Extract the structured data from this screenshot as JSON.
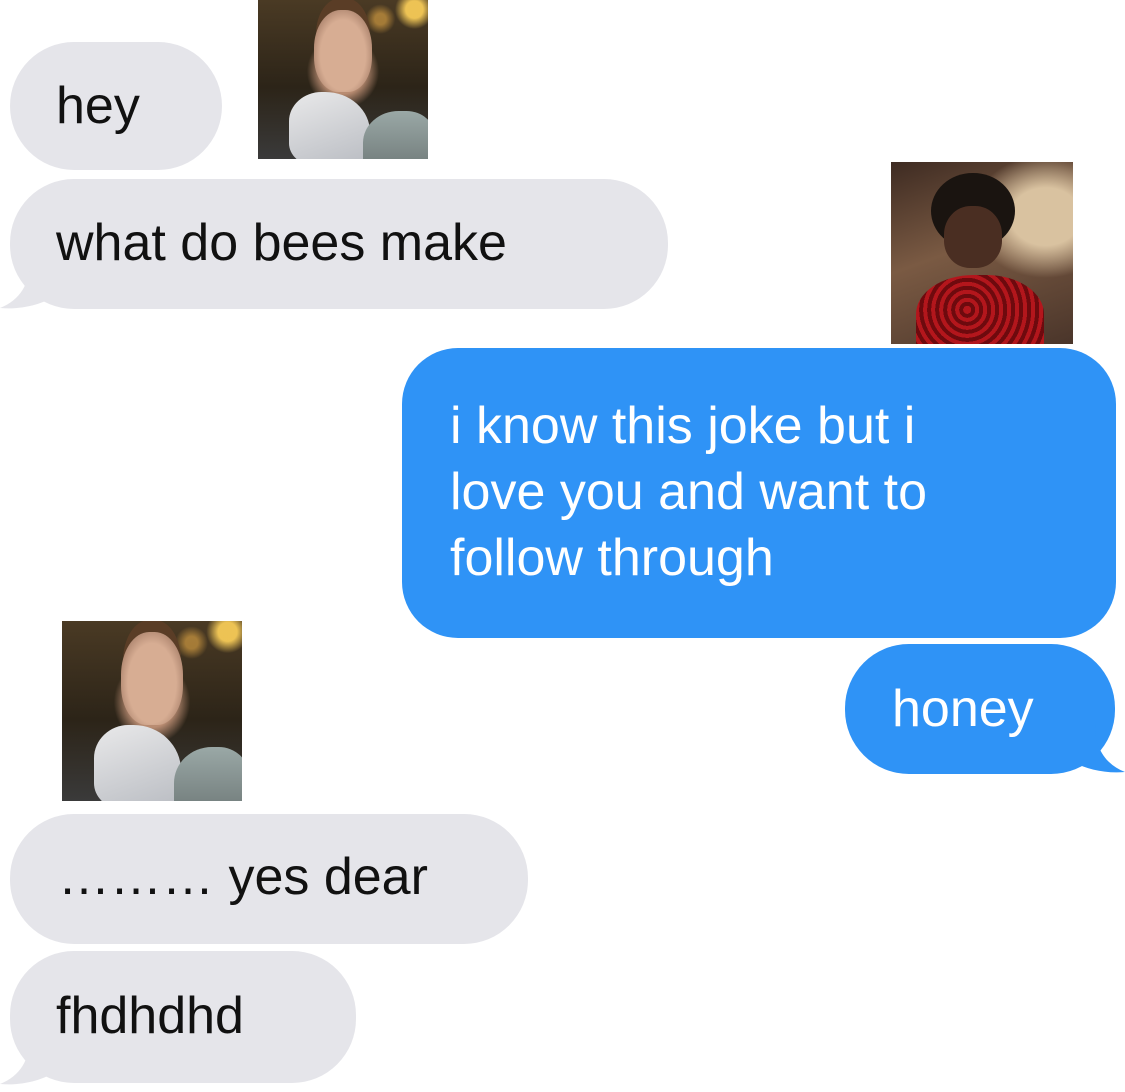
{
  "conversation": {
    "messages": [
      {
        "text": "hey",
        "direction": "received"
      },
      {
        "text": "what do bees make",
        "direction": "received"
      },
      {
        "lines": [
          "i know this joke but i",
          "love you and want to",
          "follow through"
        ],
        "direction": "sent"
      },
      {
        "text": "honey",
        "direction": "sent"
      },
      {
        "text": "……… yes dear",
        "direction": "received"
      },
      {
        "text": "fhdhdhd",
        "direction": "received"
      }
    ],
    "images": [
      {
        "name": "reaction-photo-woman-hand-over-mouth"
      },
      {
        "name": "reaction-photo-woman-red-dress"
      },
      {
        "name": "reaction-photo-woman-hand-over-mouth"
      }
    ]
  },
  "colors": {
    "received_bubble": "#e5e5ea",
    "sent_bubble": "#2f93f6",
    "received_text": "#111111",
    "sent_text": "#ffffff"
  }
}
